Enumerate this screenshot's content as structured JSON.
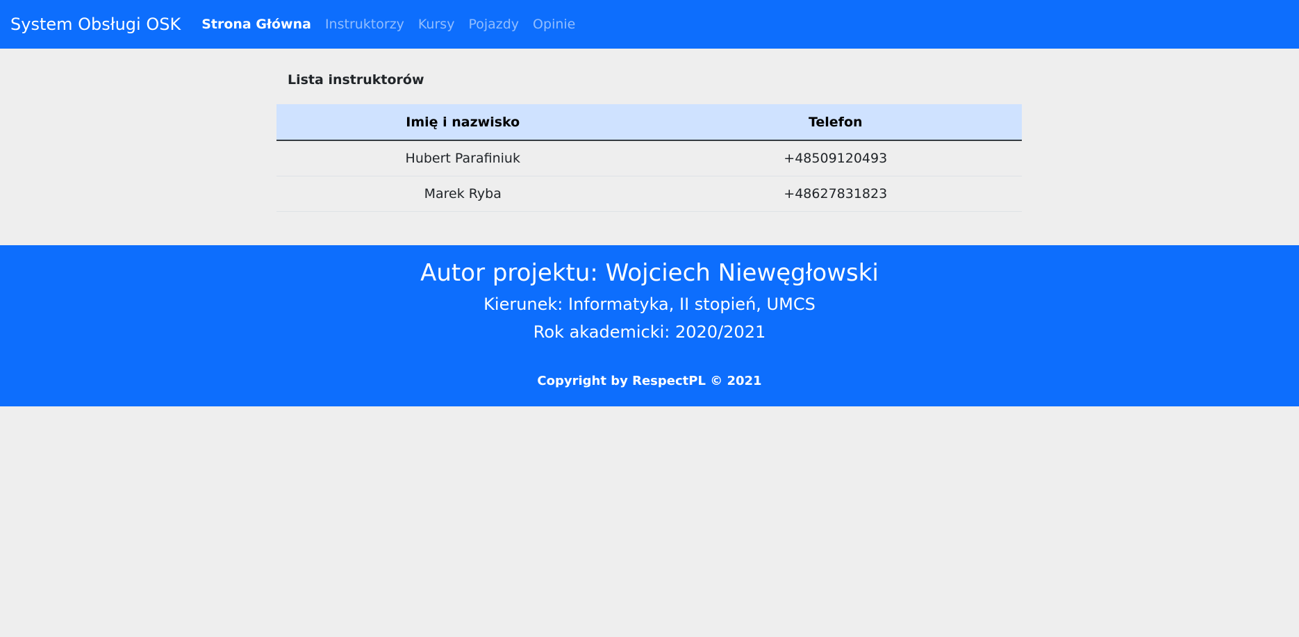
{
  "navbar": {
    "brand": "System Obsługi OSK",
    "links": [
      {
        "label": "Strona Główna",
        "active": true
      },
      {
        "label": "Instruktorzy",
        "active": false
      },
      {
        "label": "Kursy",
        "active": false
      },
      {
        "label": "Pojazdy",
        "active": false
      },
      {
        "label": "Opinie",
        "active": false
      }
    ]
  },
  "main": {
    "title": "Lista instruktorów",
    "table": {
      "headers": [
        "Imię i nazwisko",
        "Telefon"
      ],
      "rows": [
        [
          "Hubert Parafiniuk",
          "+48509120493"
        ],
        [
          "Marek Ryba",
          "+48627831823"
        ]
      ]
    }
  },
  "footer": {
    "author": "Autor projektu: Wojciech Niewęgłowski",
    "major": "Kierunek: Informatyka, II stopień, UMCS",
    "year": "Rok akademicki: 2020/2021",
    "copyright": "Copyright by RespectPL © 2021"
  },
  "colors": {
    "primary": "#0d6efd",
    "table_header_bg": "#cfe2ff",
    "page_bg": "#eeeeee"
  }
}
